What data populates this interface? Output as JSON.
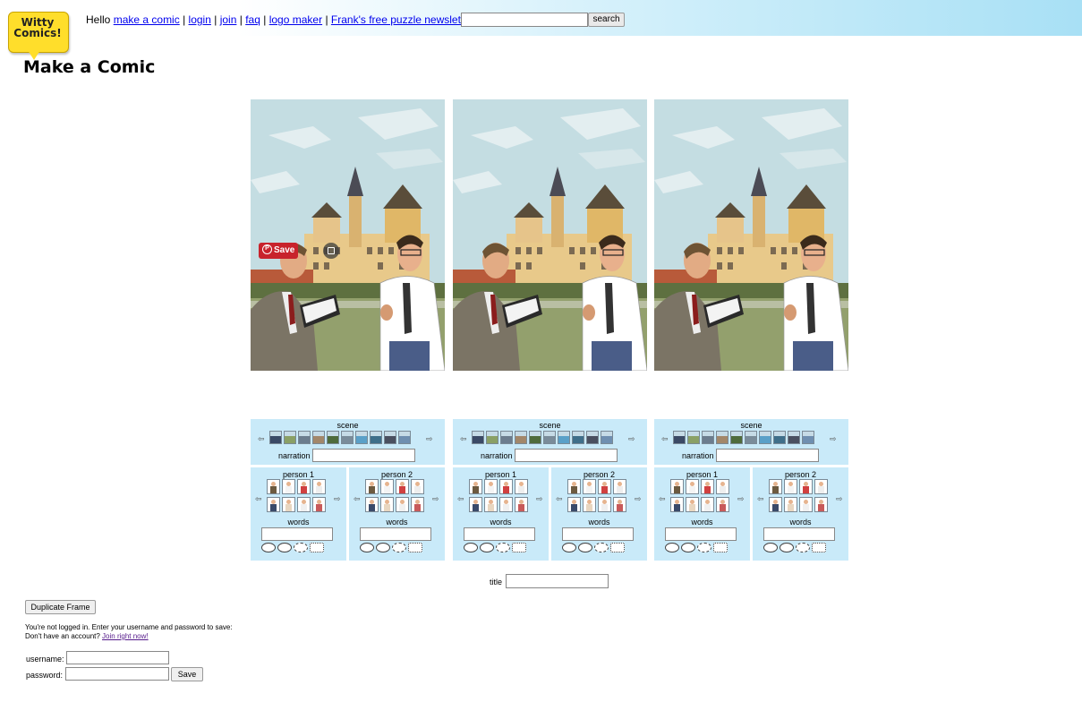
{
  "header": {
    "logo_line1": "Witty",
    "logo_line2": "Comics!",
    "greeting": "Hello",
    "links": [
      "make a comic",
      "login",
      "join",
      "faq",
      "logo maker",
      "Frank's free puzzle newsletter"
    ],
    "search_value": "",
    "search_button": "search"
  },
  "page_title": "Make a Comic",
  "panel_overlay": {
    "save_label": "Save"
  },
  "controls": {
    "scene_label": "scene",
    "narration_label": "narration",
    "person1_label": "person 1",
    "person2_label": "person 2",
    "words_label": "words",
    "arrow_left": "⇦",
    "arrow_right": "⇨"
  },
  "title_label": "title",
  "duplicate_button": "Duplicate Frame",
  "login": {
    "message_line1": "You're not logged in. Enter your username and password to save:",
    "message_line2_prefix": "Don't have an account?",
    "join_link": "Join right now!",
    "username_label": "username:",
    "password_label": "password:",
    "save_button": "Save"
  },
  "colors": {
    "control_bg": "#c9eaf9",
    "logo_yellow": "#ffde2b",
    "pinterest_red": "#c8232c"
  }
}
